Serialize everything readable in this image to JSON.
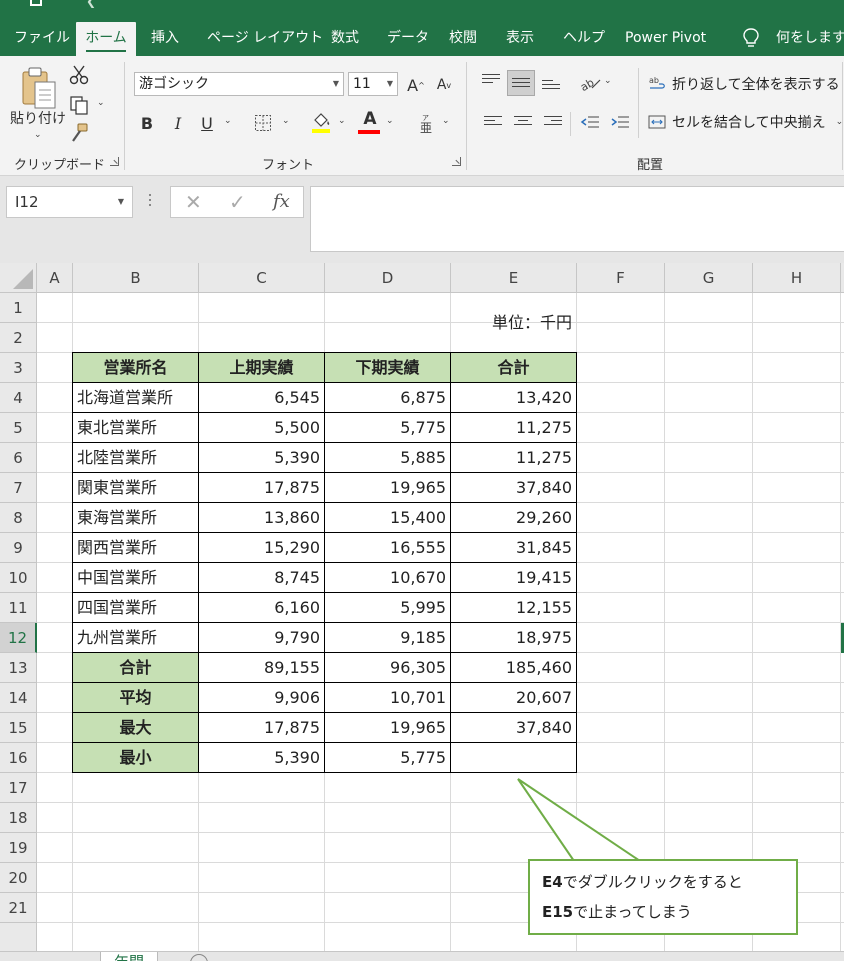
{
  "ribbon_tabs": [
    {
      "label": "ファイル",
      "active": false
    },
    {
      "label": "ホーム",
      "active": true
    },
    {
      "label": "挿入",
      "active": false
    },
    {
      "label": "ページ レイアウト",
      "active": false
    },
    {
      "label": "数式",
      "active": false
    },
    {
      "label": "データ",
      "active": false
    },
    {
      "label": "校閲",
      "active": false
    },
    {
      "label": "表示",
      "active": false
    },
    {
      "label": "ヘルプ",
      "active": false
    },
    {
      "label": "Power Pivot",
      "active": false
    }
  ],
  "tell_me": "何をしますか",
  "clipboard": {
    "paste_label": "貼り付け",
    "group_label": "クリップボード"
  },
  "font": {
    "name": "游ゴシック",
    "size": "11",
    "grow_label": "A",
    "shrink_label": "A",
    "bold": "B",
    "italic": "I",
    "underline": "U",
    "font_color_label": "A",
    "group_label": "フォント",
    "fill_color": "#ffff00",
    "font_color": "#ff0000"
  },
  "alignment": {
    "wrap_text": "折り返して全体を表示する",
    "merge_center": "セルを結合して中央揃え",
    "group_label": "配置"
  },
  "formula_bar": {
    "name_box": "I12",
    "fx": "fx",
    "cancel": "✕",
    "enter": "✓",
    "formula": ""
  },
  "sheet": {
    "columns": [
      "A",
      "B",
      "C",
      "D",
      "E",
      "F",
      "G",
      "H"
    ],
    "rows": [
      "1",
      "2",
      "3",
      "4",
      "5",
      "6",
      "7",
      "8",
      "9",
      "10",
      "11",
      "12",
      "13",
      "14",
      "15",
      "16",
      "17",
      "18",
      "19",
      "20",
      "21"
    ],
    "selected_row": "12",
    "unit_label": "単位：千円",
    "table_header": [
      "営業所名",
      "上期実績",
      "下期実績",
      "合計"
    ],
    "table_rows": [
      [
        "北海道営業所",
        "6,545",
        "6,875",
        "13,420"
      ],
      [
        "東北営業所",
        "5,500",
        "5,775",
        "11,275"
      ],
      [
        "北陸営業所",
        "5,390",
        "5,885",
        "11,275"
      ],
      [
        "関東営業所",
        "17,875",
        "19,965",
        "37,840"
      ],
      [
        "東海営業所",
        "13,860",
        "15,400",
        "29,260"
      ],
      [
        "関西営業所",
        "15,290",
        "16,555",
        "31,845"
      ],
      [
        "中国営業所",
        "8,745",
        "10,670",
        "19,415"
      ],
      [
        "四国営業所",
        "6,160",
        "5,995",
        "12,155"
      ],
      [
        "九州営業所",
        "9,790",
        "9,185",
        "18,975"
      ]
    ],
    "summary_rows": [
      [
        "合計",
        "89,155",
        "96,305",
        "185,460"
      ],
      [
        "平均",
        "9,906",
        "10,701",
        "20,607"
      ],
      [
        "最大",
        "17,875",
        "19,965",
        "37,840"
      ],
      [
        "最小",
        "5,390",
        "5,775",
        ""
      ]
    ],
    "header_fill": "#c6e0b4"
  },
  "callout": {
    "line1_bold": "E4",
    "line1_rest": "でダブルクリックをすると",
    "line2_bold": "E15",
    "line2_rest": "で止まってしまう",
    "border_color": "#70ad47"
  },
  "sheet_tab": "年間",
  "brand_color": "#217346"
}
